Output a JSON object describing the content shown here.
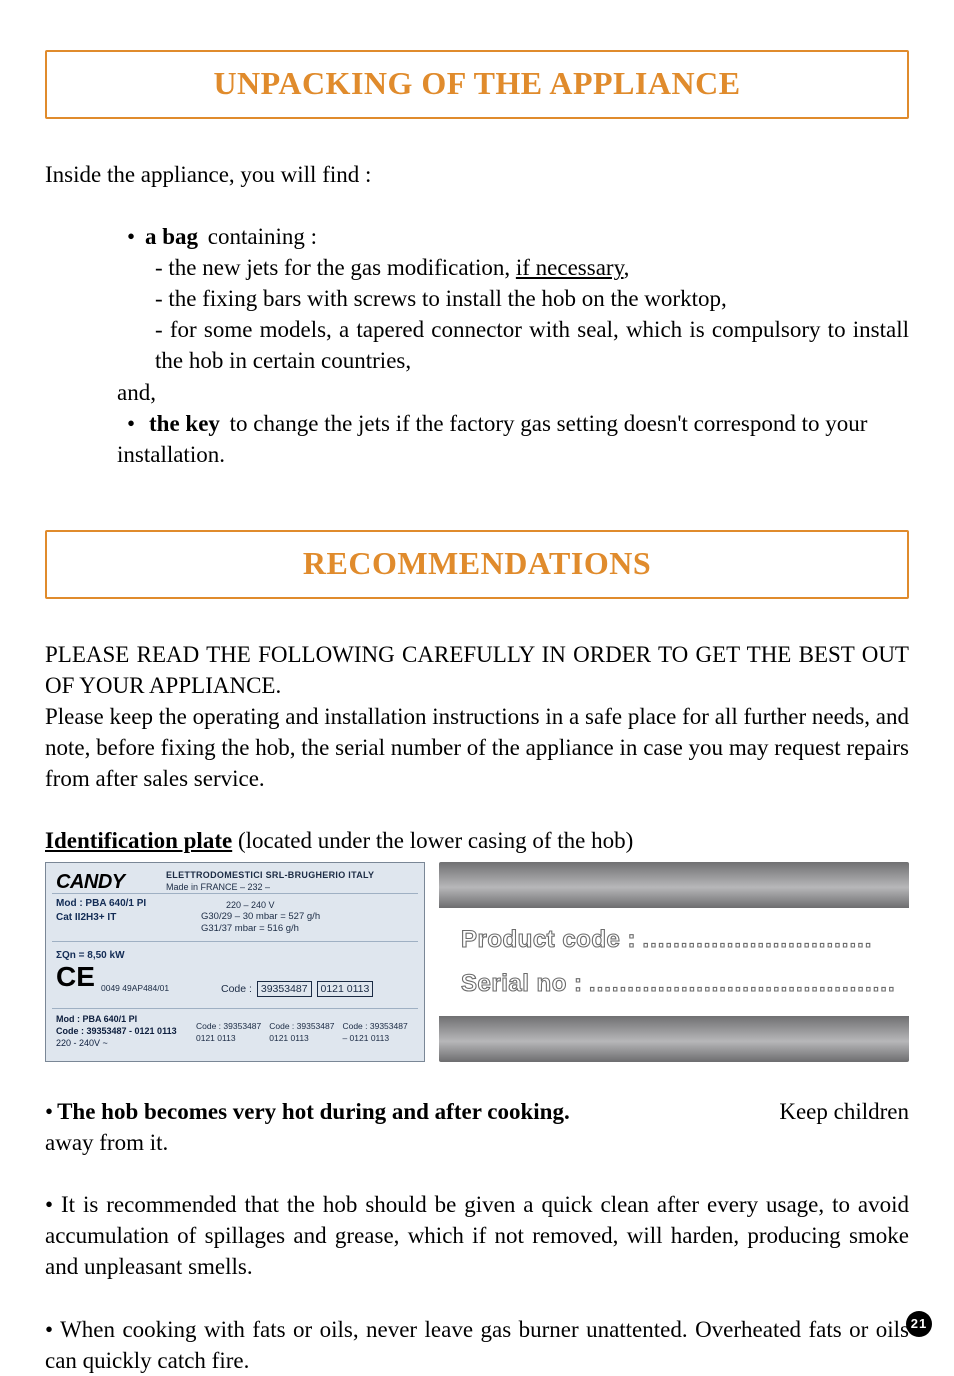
{
  "section1": {
    "title": "UNPACKING OF THE APPLIANCE",
    "intro": "Inside the appliance, you will find :",
    "bag_label": "a bag",
    "bag_containing": " containing :",
    "items": [
      "- the new jets for the gas modification, ",
      "if necessary",
      ",",
      "- the fixing bars with screws to install the hob on the worktop,",
      "- for some models, a tapered connector with seal, which is compulsory to install the hob in certain countries,"
    ],
    "and": "and,",
    "bullet": "•",
    "key_label": "the key",
    "key_text": " to change the jets if the factory gas setting doesn't correspond to your",
    "key_text2": "installation."
  },
  "section2": {
    "title": "RECOMMENDATIONS",
    "lead1": "PLEASE READ THE FOLLOWING CAREFULLY IN ORDER TO GET THE BEST OUT OF YOUR APPLIANCE.",
    "lead2": "Please keep the operating and installation instructions in a safe place for all further needs, and note, before fixing the hob, the serial number of the appliance in case you may request repairs from after sales service.",
    "plate_title": "Identification plate",
    "plate_note": " (located under the lower casing of the hob)",
    "rating_plate": {
      "brand": "CANDY",
      "headline": "ELETTRODOMESTICI SRL-BRUGHERIO ITALY",
      "made": "Made in FRANCE – 232 –",
      "mod": "Mod : PBA 640/1 PI",
      "cat": "Cat II2H3+   IT",
      "volts": "220 – 240 V",
      "gas1": "G30/29 – 30 mbar = 527 g/h",
      "gas2": "G31/37 mbar = 516 g/h",
      "kw": "ΣQn = 8,50 kW",
      "ce": "CE",
      "cenum": "0049 49AP484/01",
      "code_label": "Code :",
      "code_value": "39353487",
      "code_batch": "0121 0113",
      "mod2": "Mod : PBA 640/1 PI",
      "codeline2": "Code : 39353487 - 0121 0113",
      "vline2": "220 - 240V ~",
      "trio_a": "Code : 39353487",
      "trio_b": "Code : 39353487",
      "trio_c": "Code : 39353487",
      "trio_a2": "0121 0113",
      "trio_b2": "0121 0113",
      "trio_c2": "– 0121 0113"
    },
    "infobox": {
      "product_code": "Product code :",
      "dots1": "..............................",
      "serial_no": "Serial no :",
      "dots2": "........................................"
    }
  },
  "bottom": {
    "bullet": "•",
    "warn_label": "The hob becomes very hot during and after cooking.",
    "warn_right": "Keep children",
    "warn_line2": "away from it.",
    "p2": "• It is recommended that the hob should be given a quick clean after every usage, to avoid accumulation of spillages and grease, which if not removed, will harden, producing smoke and unpleasant smells.",
    "p3": "• When cooking with fats or oils, never leave gas burner unattented. Overheated fats or oils can quickly catch fire."
  },
  "page_number": "21"
}
